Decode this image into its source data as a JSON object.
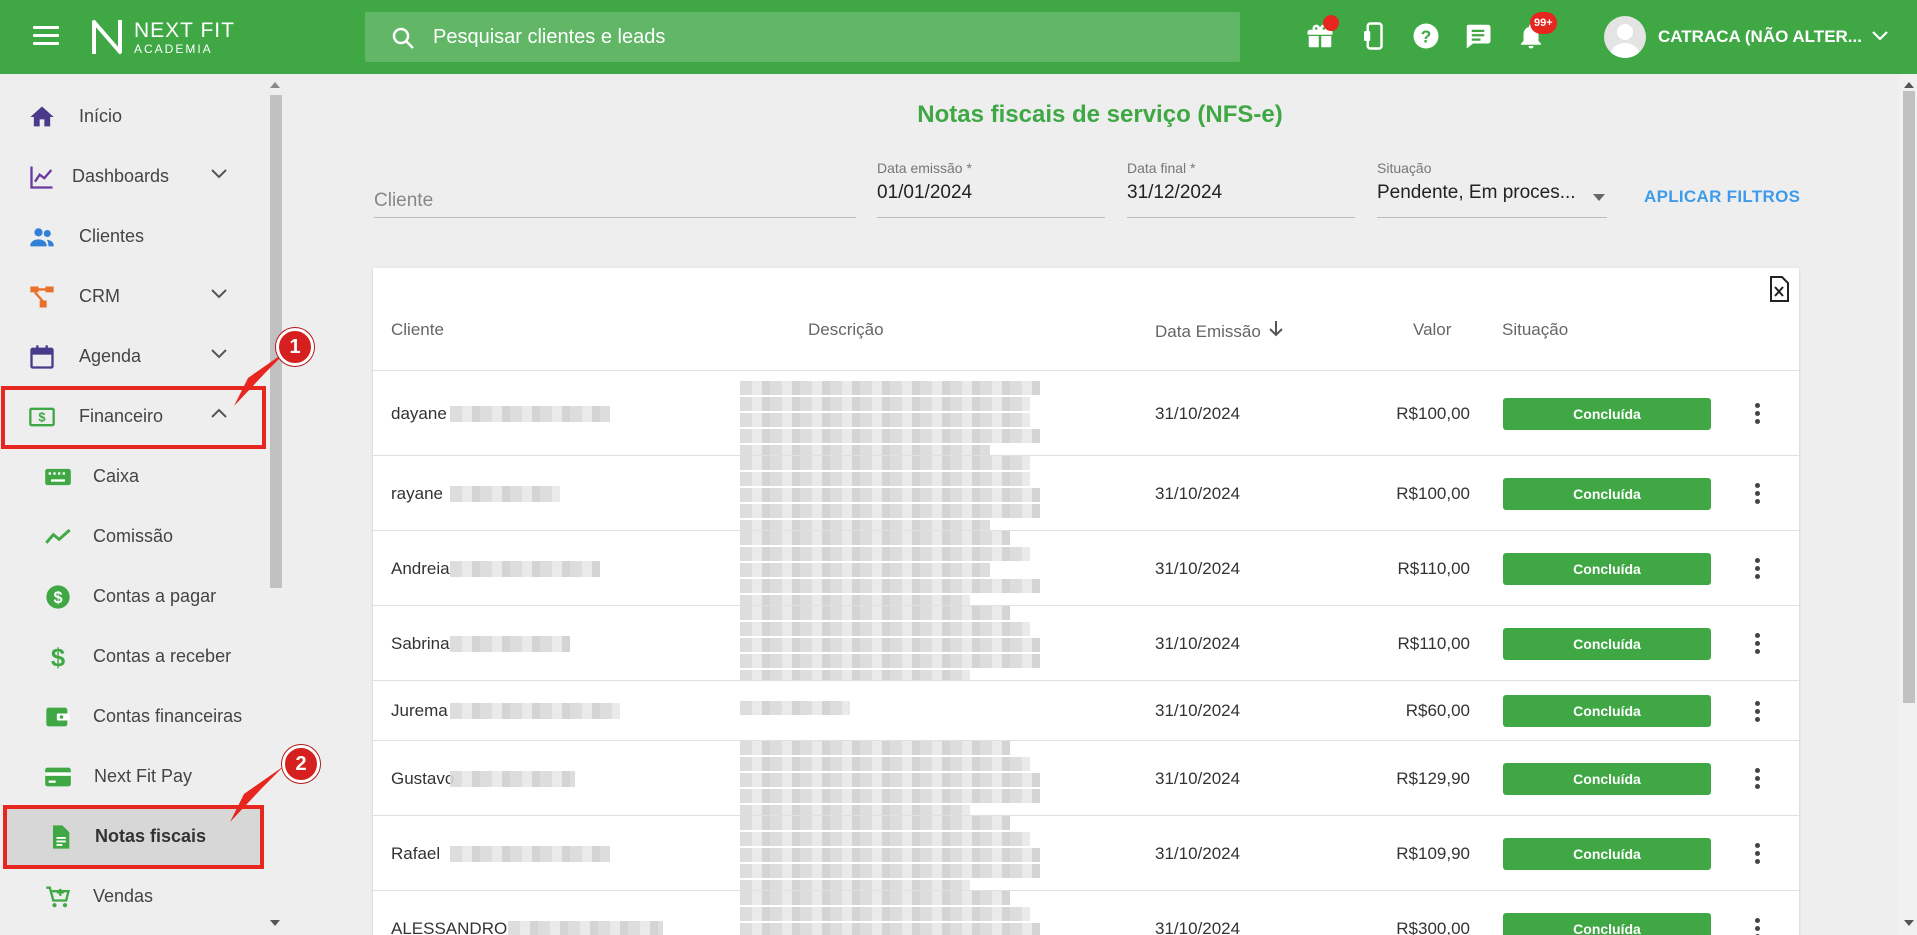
{
  "header": {
    "brand_line1": "NEXT FIT",
    "brand_line2": "ACADEMIA",
    "search_placeholder": "Pesquisar clientes e leads",
    "notifications_badge": "99+",
    "user_name": "CATRACA (NÃO ALTER..."
  },
  "sidebar": {
    "items": [
      {
        "label": "Início",
        "icon": "home-icon"
      },
      {
        "label": "Dashboards",
        "icon": "chart-line-icon"
      },
      {
        "label": "Clientes",
        "icon": "people-icon"
      },
      {
        "label": "CRM",
        "icon": "flow-icon"
      },
      {
        "label": "Agenda",
        "icon": "calendar-icon"
      },
      {
        "label": "Financeiro",
        "icon": "money-icon"
      },
      {
        "label": "Caixa",
        "icon": "keyboard-icon"
      },
      {
        "label": "Comissão",
        "icon": "trend-icon"
      },
      {
        "label": "Contas a pagar",
        "icon": "dollar-circle-icon"
      },
      {
        "label": "Contas a receber",
        "icon": "dollar-icon"
      },
      {
        "label": "Contas financeiras",
        "icon": "wallet-icon"
      },
      {
        "label": "Next Fit Pay",
        "icon": "card-icon"
      },
      {
        "label": "Notas fiscais",
        "icon": "document-icon"
      },
      {
        "label": "Vendas",
        "icon": "cart-icon"
      }
    ],
    "active": "Notas fiscais"
  },
  "annotations": [
    "1",
    "2"
  ],
  "main": {
    "title": "Notas fiscais de serviço (NFS-e)",
    "filters": {
      "cliente_placeholder": "Cliente",
      "data_emissao_label": "Data emissão *",
      "data_emissao_value": "01/01/2024",
      "data_final_label": "Data final *",
      "data_final_value": "31/12/2024",
      "situacao_label": "Situação",
      "situacao_value": "Pendente, Em proces...",
      "apply_label": "APLICAR FILTROS"
    },
    "table": {
      "columns": [
        "Cliente",
        "Descrição",
        "Data Emissão",
        "Valor",
        "Situação"
      ],
      "rows": [
        {
          "cliente": "dayane",
          "data": "31/10/2024",
          "valor": "R$100,00",
          "situacao": "Concluída"
        },
        {
          "cliente": "rayane",
          "data": "31/10/2024",
          "valor": "R$100,00",
          "situacao": "Concluída"
        },
        {
          "cliente": "Andreia",
          "data": "31/10/2024",
          "valor": "R$110,00",
          "situacao": "Concluída"
        },
        {
          "cliente": "Sabrina",
          "data": "31/10/2024",
          "valor": "R$110,00",
          "situacao": "Concluída"
        },
        {
          "cliente": "Jurema",
          "data": "31/10/2024",
          "valor": "R$60,00",
          "situacao": "Concluída"
        },
        {
          "cliente": "Gustavo",
          "data": "31/10/2024",
          "valor": "R$129,90",
          "situacao": "Concluída"
        },
        {
          "cliente": "Rafael",
          "data": "31/10/2024",
          "valor": "R$109,90",
          "situacao": "Concluída"
        },
        {
          "cliente": "ALESSANDRO",
          "data": "31/10/2024",
          "valor": "R$300,00",
          "situacao": "Concluída"
        }
      ]
    }
  },
  "colors": {
    "brand_green": "#3fa845",
    "link_blue": "#3d9be9",
    "annotation_red": "#e6261f"
  }
}
